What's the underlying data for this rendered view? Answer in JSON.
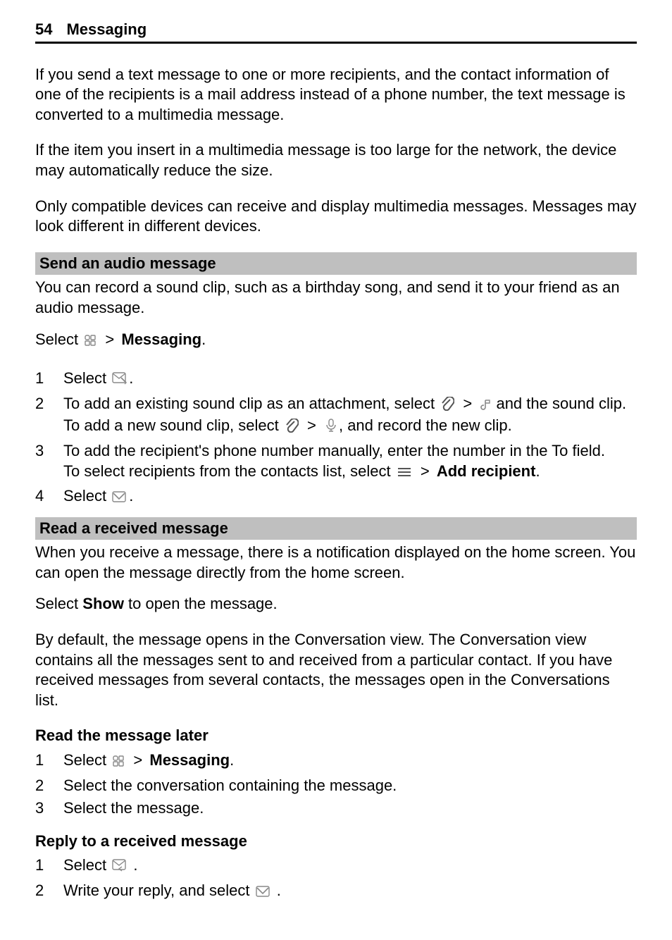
{
  "header": {
    "page_number": "54",
    "title": "Messaging"
  },
  "intro": {
    "p1": "If you send a text message to one or more recipients, and the contact information of one of the recipients is a mail address instead of a phone number, the text message is converted to a multimedia message.",
    "p2": "If the item you insert in a multimedia message is too large for the network, the device may automatically reduce the size.",
    "p3": "Only compatible devices can receive and display multimedia messages. Messages may look different in different devices."
  },
  "audio": {
    "heading": "Send an audio message",
    "intro": "You can record a sound clip, such as a birthday song, and send it to your friend as an audio message.",
    "select_prefix": "Select ",
    "messaging_label": "Messaging",
    "period": ".",
    "steps": {
      "s1": {
        "num": "1",
        "select": "Select ",
        "period": "."
      },
      "s2": {
        "num": "2",
        "line1_a": "To add an existing sound clip as an attachment, select ",
        "line1_b": " and the sound clip.",
        "line2_a": "To add a new sound clip, select ",
        "line2_b": ", and record the new clip."
      },
      "s3": {
        "num": "3",
        "line1": "To add the recipient's phone number manually, enter the number in the To field.",
        "line2_a": "To select recipients from the contacts list, select ",
        "add_recipient": "Add recipient",
        "line2_b": "."
      },
      "s4": {
        "num": "4",
        "select": "Select ",
        "period": "."
      }
    }
  },
  "read": {
    "heading": "Read a received message",
    "p1": "When you receive a message, there is a notification displayed on the home screen. You can open the message directly from the home screen.",
    "p2_a": "Select ",
    "show": "Show",
    "p2_b": " to open the message.",
    "p3": "By default, the message opens in the Conversation view. The Conversation view contains all the messages sent to and received from a particular contact. If you have received messages from several contacts, the messages open in the Conversations list."
  },
  "later": {
    "heading": "Read the message later",
    "steps": {
      "s1": {
        "num": "1",
        "select": "Select ",
        "messaging": "Messaging",
        "period": "."
      },
      "s2": {
        "num": "2",
        "text": "Select the conversation containing the message."
      },
      "s3": {
        "num": "3",
        "text": "Select the message."
      }
    }
  },
  "reply": {
    "heading": "Reply to a received message",
    "steps": {
      "s1": {
        "num": "1",
        "select": "Select ",
        "period": " ."
      },
      "s2": {
        "num": "2",
        "a": "Write your reply, and select ",
        "b": " ."
      }
    }
  },
  "symbols": {
    "gt": ">"
  }
}
